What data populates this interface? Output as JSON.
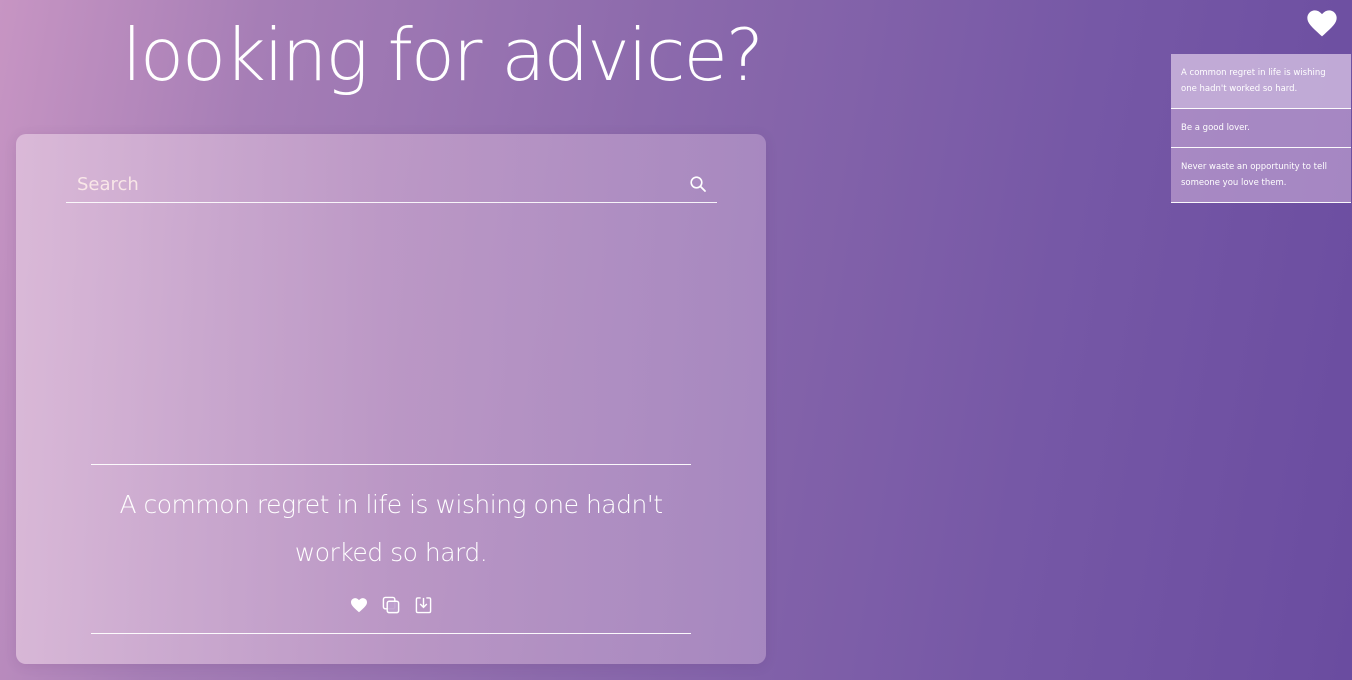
{
  "header": {
    "title": "looking for advice?"
  },
  "search": {
    "placeholder": "Search",
    "value": ""
  },
  "advice": {
    "text": "A common regret in life is wishing one hadn't worked so hard."
  },
  "actions": {
    "favorite_icon": "heart-icon",
    "copy_icon": "copy-icon",
    "download_icon": "download-icon"
  },
  "favorites": {
    "toggle_icon": "heart-icon",
    "items": [
      {
        "text": "A common regret in life is wishing one hadn't worked so hard."
      },
      {
        "text": "Be a good lover."
      },
      {
        "text": "Never waste an opportunity to tell someone you love them."
      }
    ]
  },
  "colors": {
    "background_start": "#c795c3",
    "background_end": "#6a4ca0",
    "text": "#ffffff"
  }
}
